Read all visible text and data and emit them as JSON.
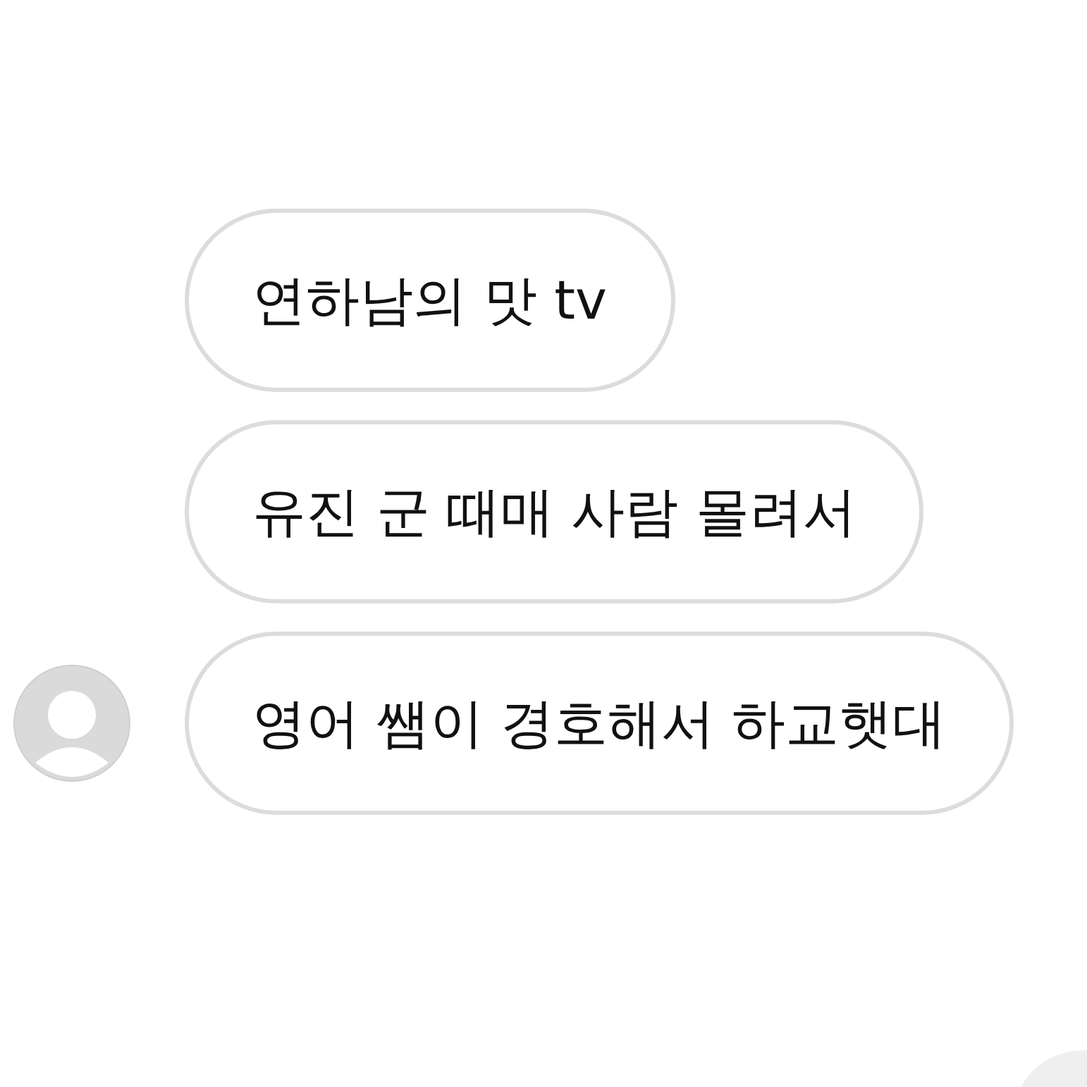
{
  "messages": [
    {
      "text": "연하남의 맛 tv"
    },
    {
      "text": "유진 군 때매 사람 몰려서"
    },
    {
      "text": "영어 쌤이 경호해서 하교햇대"
    }
  ]
}
